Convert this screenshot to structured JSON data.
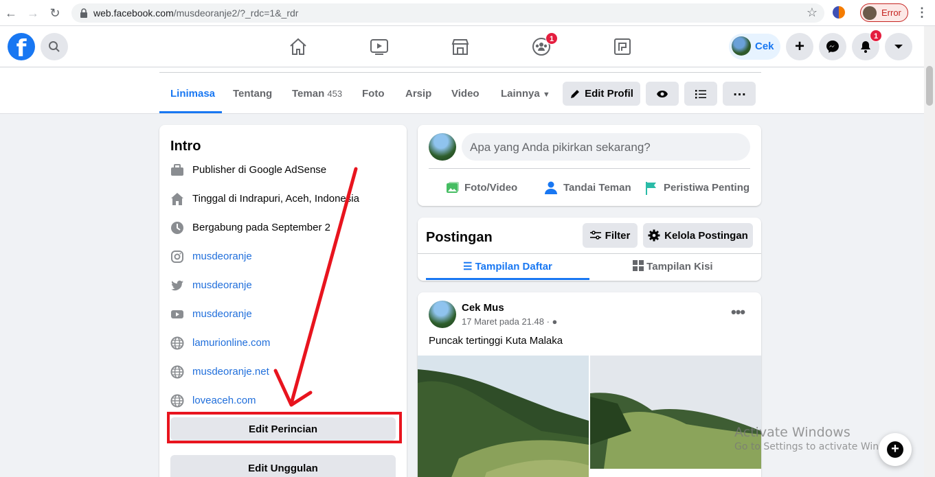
{
  "browser": {
    "url_host": "web.facebook.com",
    "url_path": "/musdeoranje2/?_rdc=1&_rdr",
    "profile_status": "Error"
  },
  "topnav": {
    "profile_name": "Cek",
    "groups_badge": "1",
    "notifications_badge": "1"
  },
  "profile_tabs": {
    "items": [
      {
        "label": "Linimasa",
        "count": ""
      },
      {
        "label": "Tentang",
        "count": ""
      },
      {
        "label": "Teman",
        "count": "453"
      },
      {
        "label": "Foto",
        "count": ""
      },
      {
        "label": "Arsip",
        "count": ""
      },
      {
        "label": "Video",
        "count": ""
      },
      {
        "label": "Lainnya",
        "count": ""
      }
    ],
    "edit_profile": "Edit Profil"
  },
  "intro": {
    "title": "Intro",
    "work_prefix": "Publisher di ",
    "work_place": "Google AdSense",
    "lives_prefix": "Tinggal di ",
    "lives_place": "Indrapuri, Aceh, Indonesia",
    "joined": "Bergabung pada September 2",
    "links": [
      {
        "icon": "instagram-icon",
        "label": "musdeoranje"
      },
      {
        "icon": "twitter-icon",
        "label": "musdeoranje"
      },
      {
        "icon": "youtube-icon",
        "label": "musdeoranje"
      },
      {
        "icon": "globe-icon",
        "label": "lamurionline.com"
      },
      {
        "icon": "globe-icon",
        "label": "musdeoranje.net"
      },
      {
        "icon": "globe-icon",
        "label": "loveaceh.com"
      }
    ],
    "edit_details": "Edit Perincian",
    "edit_featured": "Edit Unggulan"
  },
  "composer": {
    "placeholder": "Apa yang Anda pikirkan sekarang?",
    "actions": [
      "Foto/Video",
      "Tandai Teman",
      "Peristiwa Penting"
    ]
  },
  "posts": {
    "title": "Postingan",
    "filter": "Filter",
    "manage": "Kelola Postingan",
    "view_list": "Tampilan Daftar",
    "view_grid": "Tampilan Kisi"
  },
  "post": {
    "author": "Cek Mus",
    "meta": "17 Maret pada 21.48 · ",
    "text": "Puncak tertinggi Kuta Malaka"
  },
  "watermark": {
    "line1": "Activate Windows",
    "line2": "Go to Settings to activate Windows."
  },
  "colors": {
    "brand": "#1877f2",
    "highlight_red": "#e8141e"
  }
}
